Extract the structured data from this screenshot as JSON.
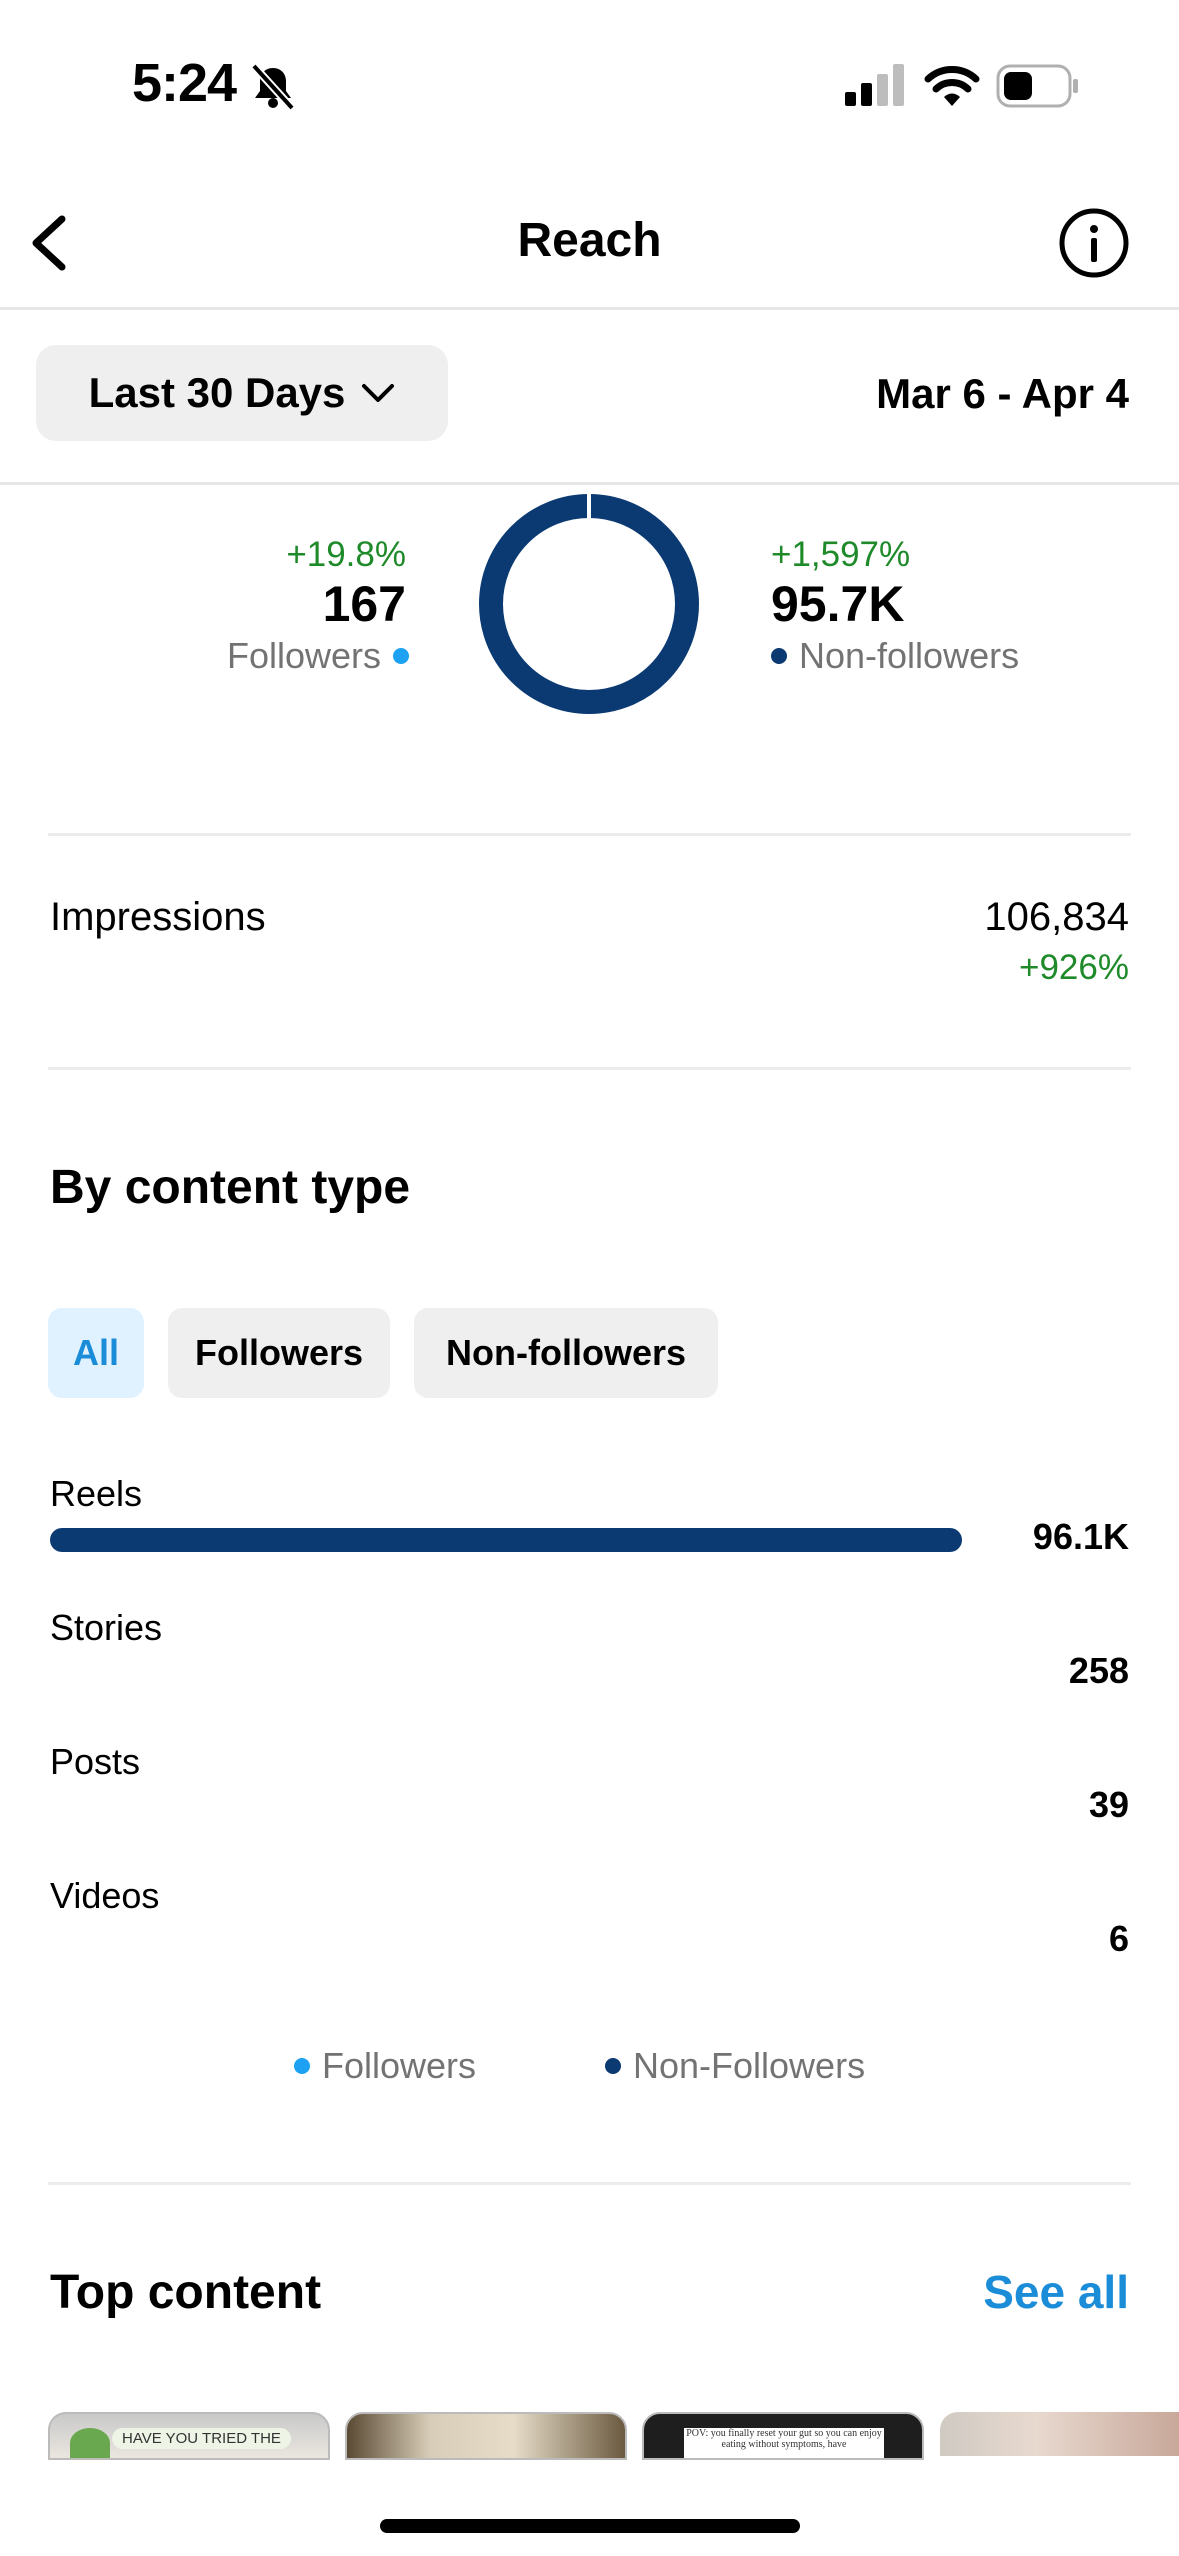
{
  "status_bar": {
    "time": "5:24"
  },
  "header": {
    "title": "Reach"
  },
  "filter": {
    "range_label": "Last 30 Days",
    "dates": "Mar 6 - Apr 4"
  },
  "reach": {
    "followers": {
      "change": "+19.8%",
      "value": "167",
      "label": "Followers",
      "color": "#1da1f2"
    },
    "non_followers": {
      "change": "+1,597%",
      "value": "95.7K",
      "label": "Non-followers",
      "color": "#0b3a73"
    },
    "donut_followers_fraction": 0.0017
  },
  "impressions": {
    "label": "Impressions",
    "value": "106,834",
    "change": "+926%"
  },
  "content_type": {
    "title": "By content type",
    "chips": [
      "All",
      "Followers",
      "Non-followers"
    ],
    "active_chip": "All",
    "rows": [
      {
        "label": "Reels",
        "value": "96.1K",
        "fraction": 1.0
      },
      {
        "label": "Stories",
        "value": "258",
        "fraction": 0.0
      },
      {
        "label": "Posts",
        "value": "39",
        "fraction": 0.0
      },
      {
        "label": "Videos",
        "value": "6",
        "fraction": 0.0
      }
    ],
    "legend": [
      {
        "label": "Followers",
        "color": "#1da1f2"
      },
      {
        "label": "Non-Followers",
        "color": "#0b3a73"
      }
    ]
  },
  "top_content": {
    "title": "Top content",
    "see_all": "See all",
    "thumbs": [
      {
        "caption": "HAVE YOU TRIED THE"
      },
      {
        "caption": ""
      },
      {
        "caption": "POV: you finally reset your gut so you can enjoy eating without symptoms, have"
      },
      {
        "caption": ""
      }
    ]
  },
  "colors": {
    "accent_blue": "#1a8cd8",
    "navy": "#0b3a73",
    "green": "#1f8a2a"
  }
}
